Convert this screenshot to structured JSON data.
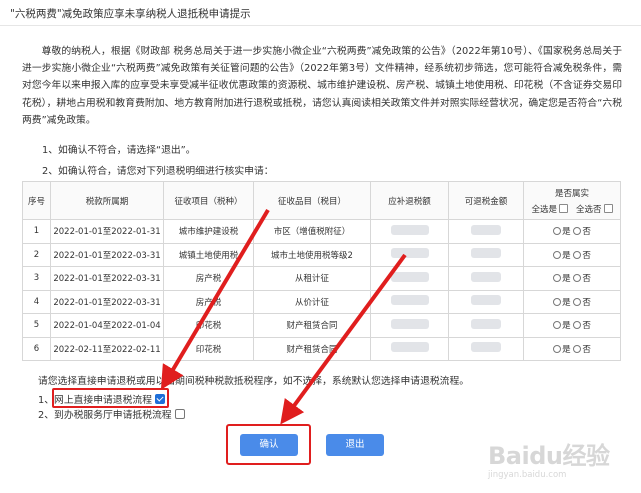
{
  "window": {
    "title": "\"六税两费\"减免政策应享未享纳税人退抵税申请提示"
  },
  "intro": {
    "text": "尊敬的纳税人，根据《财政部 税务总局关于进一步实施小微企业“六税两费”减免政策的公告》（2022年第10号）、《国家税务总局关于进一步实施小微企业“六税两费”减免政策有关征管问题的公告》（2022年第3号）文件精神，经系统初步筛选，您可能符合减免税条件，需对您今年以来申报入库的应享受未享受减半征收优惠政策的资源税、城市维护建设税、房产税、城镇土地使用税、印花税（不含证券交易印花税），耕地占用税和教育费附加、地方教育附加进行退税或抵税，请您认真阅读相关政策文件并对照实际经营状况，确定您是否符合“六税两费”减免政策。"
  },
  "tips": {
    "t1": "1、如确认不符合，请选择“退出”。",
    "t2": "2、如确认符合，请您对下列退税明细进行核实申请："
  },
  "table": {
    "headers": {
      "seq": "序号",
      "period": "税款所属期",
      "item": "征收项目（税种）",
      "subitem": "征收品目（税目）",
      "should": "应补退税额",
      "refund": "可退税金额",
      "confirm": "是否属实",
      "select_yes": "全选是",
      "select_no": "全选否"
    },
    "yes": "是",
    "no": "否",
    "rows": [
      {
        "seq": "1",
        "period": "2022-01-01至2022-01-31",
        "item": "城市维护建设税",
        "subitem": "市区（增值税附征）"
      },
      {
        "seq": "2",
        "period": "2022-01-01至2022-03-31",
        "item": "城镇土地使用税",
        "subitem": "城市土地使用税等级2"
      },
      {
        "seq": "3",
        "period": "2022-01-01至2022-03-31",
        "item": "房产税",
        "subitem": "从租计征"
      },
      {
        "seq": "4",
        "period": "2022-01-01至2022-03-31",
        "item": "房产税",
        "subitem": "从价计征"
      },
      {
        "seq": "5",
        "period": "2022-01-04至2022-01-04",
        "item": "印花税",
        "subitem": "财产租赁合同"
      },
      {
        "seq": "6",
        "period": "2022-02-11至2022-02-11",
        "item": "印花税",
        "subitem": "财产租赁合同"
      }
    ]
  },
  "options": {
    "note": "请您选择直接申请退税或用以后期间税种税款抵税程序，如不选择，系统默认您选择申请退税流程。",
    "opt1": "1、网上直接申请退税流程",
    "opt1_checked": true,
    "opt2": "2、到办税服务厅申请抵税流程",
    "opt2_checked": false
  },
  "buttons": {
    "confirm": "确认",
    "exit": "退出"
  },
  "watermark": {
    "logo": "Baidu经验",
    "url": "jingyan.baidu.com"
  },
  "colors": {
    "primary_button": "#4a8be9",
    "annotation_red": "#e01e1e",
    "checkbox_checked": "#1e6fd9"
  }
}
